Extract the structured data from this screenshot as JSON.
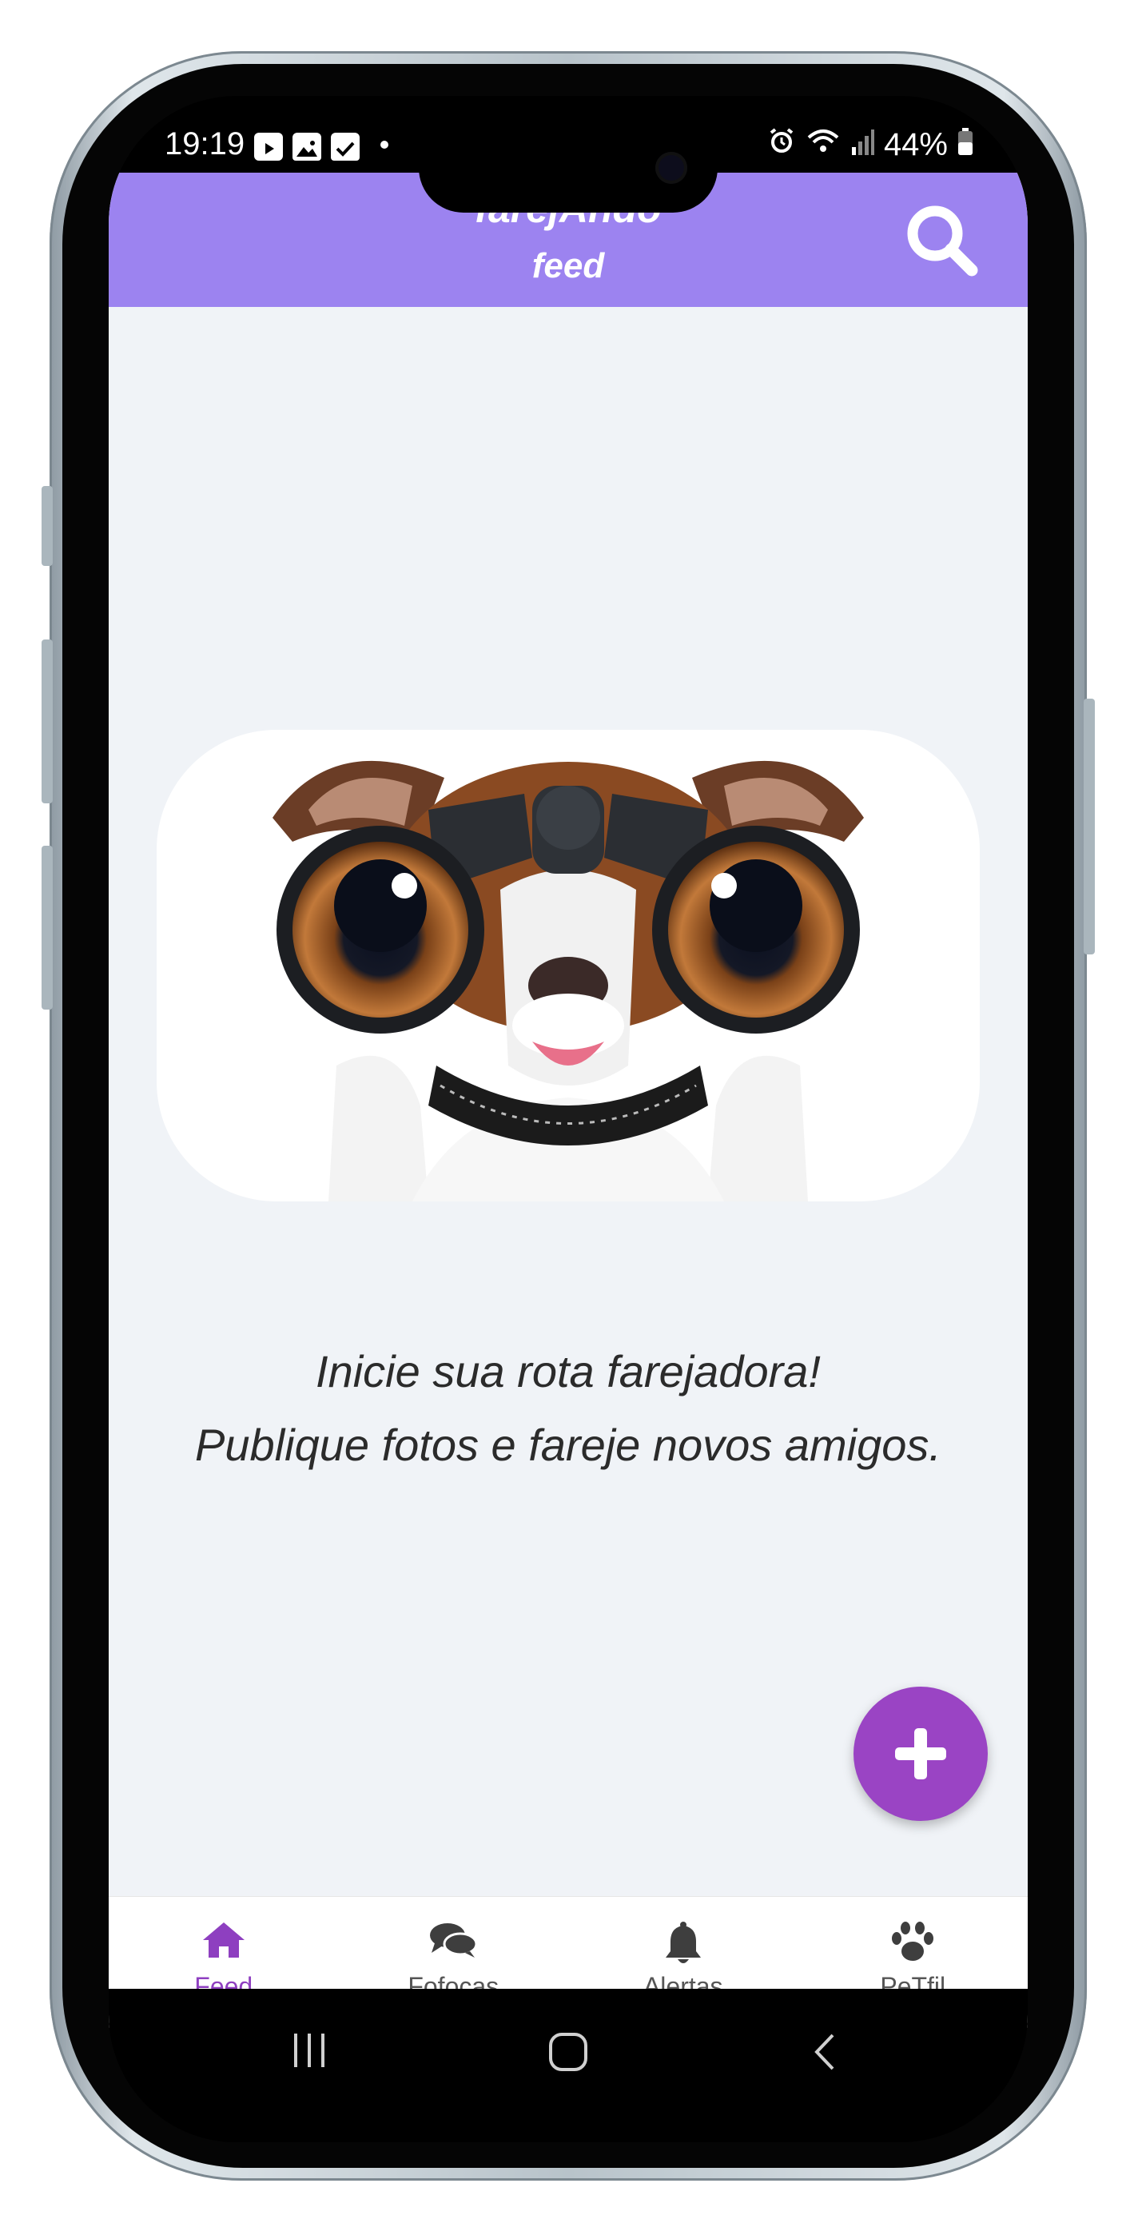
{
  "status_bar": {
    "time": "19:19",
    "battery": "44%",
    "icons_left": [
      "youtube-icon",
      "gallery-icon",
      "check-icon",
      "dot-icon"
    ],
    "icons_right": [
      "alarm-icon",
      "wifi-icon",
      "signal-icon",
      "battery-icon"
    ]
  },
  "header": {
    "title": "farejAndo",
    "subtitle": "feed",
    "search_icon": "search-icon",
    "background": "#9c83f0"
  },
  "main": {
    "hero_image": "dog-with-binoculars",
    "message_line1": "Inicie sua rota farejadora!",
    "message_line2": "Publique fotos e fareje novos amigos."
  },
  "fab": {
    "icon": "plus-icon",
    "color": "#9a44c4"
  },
  "bottom_nav": {
    "active_color": "#8e3fc0",
    "items": [
      {
        "label": "Feed",
        "icon": "home-icon",
        "active": true
      },
      {
        "label": "Fofocas",
        "icon": "chat-bubbles-icon",
        "active": false
      },
      {
        "label": "Alertas",
        "icon": "bell-icon",
        "active": false
      },
      {
        "label": "PeTfil",
        "icon": "paw-icon",
        "active": false
      }
    ]
  },
  "system_nav": [
    "recents-icon",
    "home-circle-icon",
    "back-icon"
  ]
}
